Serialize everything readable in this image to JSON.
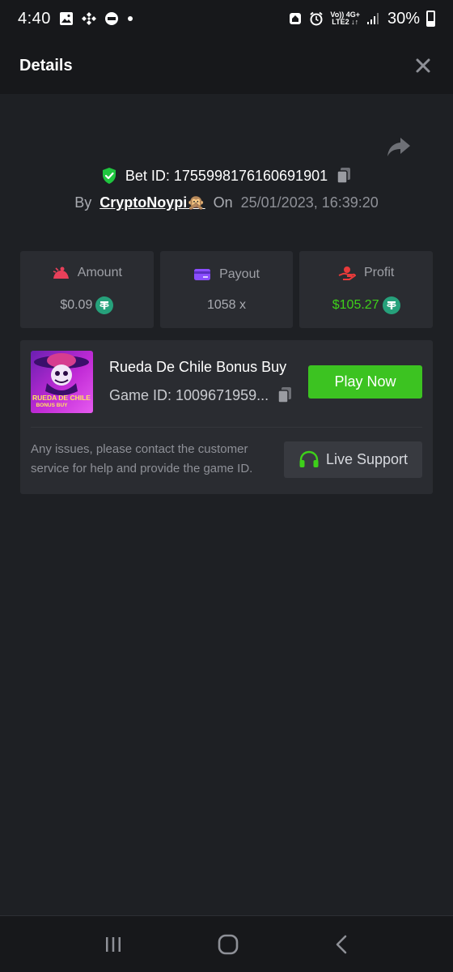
{
  "status_bar": {
    "time": "4:40",
    "battery": "30%",
    "network_top": "Vo)) 4G+",
    "network_bottom": "LTE2 ↓↑"
  },
  "header": {
    "title": "Details"
  },
  "bet": {
    "id_label": "Bet ID: 1755998176160691901",
    "by_label": "By",
    "user": "CryptoNoypi🙊",
    "on_label": "On",
    "date": "25/01/2023, 16:39:20"
  },
  "stats": [
    {
      "label": "Amount",
      "value": "$0.09",
      "icon": "amount-icon",
      "color": "#e8405a"
    },
    {
      "label": "Payout",
      "value": "1058 x",
      "icon": "card-icon",
      "color": "#8a4dff"
    },
    {
      "label": "Profit",
      "value": "$105.27",
      "icon": "profit-icon",
      "color": "#e83a3a",
      "value_color": "#3ed01a"
    }
  ],
  "game": {
    "name": "Rueda De Chile Bonus Buy",
    "id": "Game ID: 1009671959...",
    "thumb_title": "RUEDA DE CHILE",
    "thumb_sub": "BONUS BUY",
    "play_label": "Play Now"
  },
  "support": {
    "text": "Any issues, please contact the customer service for help and provide the game ID.",
    "button_label": "Live Support"
  },
  "colors": {
    "background": "#1e2024",
    "card": "#2a2c31",
    "accent_green": "#3cc321",
    "tether": "#26a17b"
  }
}
